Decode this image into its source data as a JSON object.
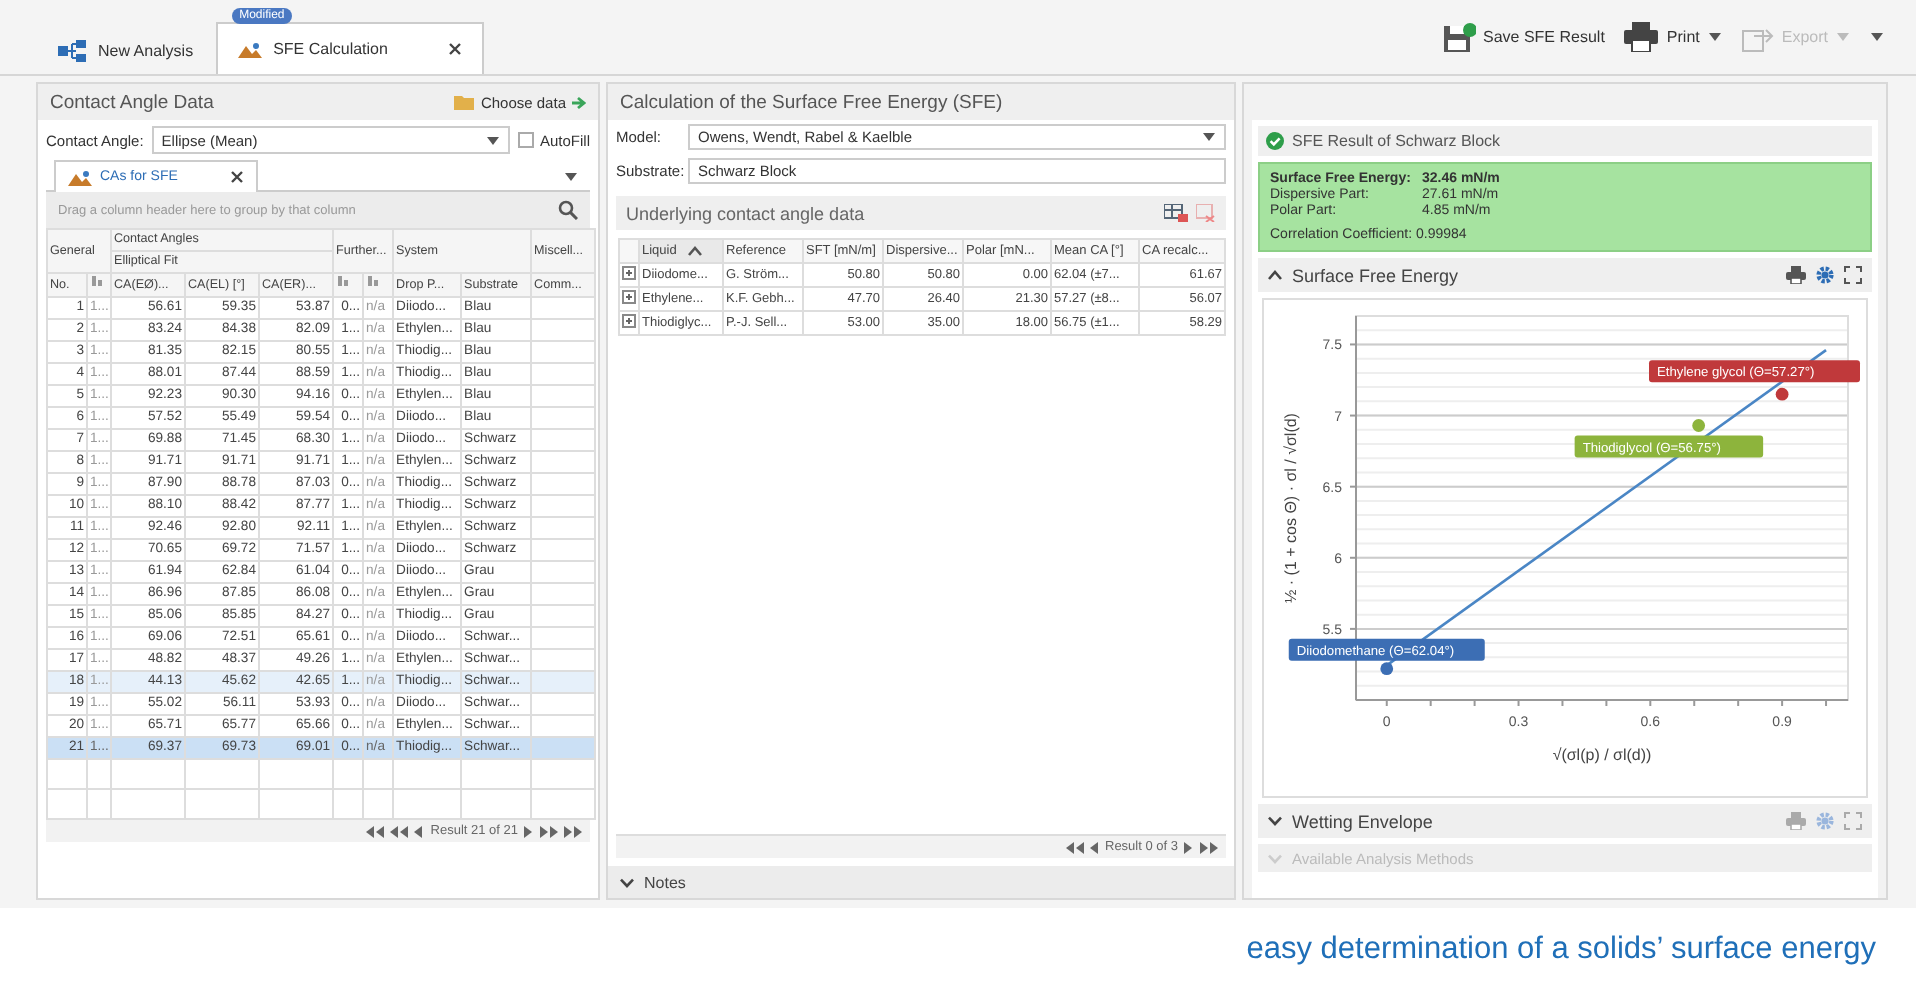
{
  "tabs": [
    {
      "label": "New Analysis",
      "selected": false,
      "closable": false
    },
    {
      "label": "SFE Calculation",
      "selected": true,
      "closable": true,
      "badge": "Modified"
    }
  ],
  "toolbar": [
    {
      "label": "Save SFE Result",
      "kind": "save",
      "disabled": false,
      "dropdown": false
    },
    {
      "label": "Print",
      "kind": "print",
      "disabled": false,
      "dropdown": true
    },
    {
      "label": "Export",
      "kind": "export",
      "disabled": true,
      "dropdown": true
    }
  ],
  "contact_angle_data": {
    "title": "Contact Angle Data",
    "choose_data": "Choose data",
    "angle_label": "Contact Angle:",
    "angle_value": "Ellipse (Mean)",
    "autofill": {
      "label": "AutoFill",
      "checked": false
    },
    "tab": "CAs for SFE",
    "group_hint": "Drag a column header here to group by that column",
    "column_groups": [
      {
        "label": "General",
        "columns": [
          {
            "label": "No.",
            "kind": "text"
          },
          {
            "kind": "icon"
          }
        ]
      },
      {
        "label": "Contact Angles",
        "subgroup": "Elliptical Fit",
        "columns": [
          {
            "label": "CA(EØ)...",
            "kind": "text"
          },
          {
            "label": "CA(EL) [°]",
            "kind": "text"
          },
          {
            "label": "CA(ER)...",
            "kind": "text"
          }
        ]
      },
      {
        "label": "Further...",
        "columns": [
          {
            "kind": "icon"
          },
          {
            "kind": "icon"
          }
        ]
      },
      {
        "label": "System",
        "columns": [
          {
            "label": "Drop P...",
            "kind": "text"
          },
          {
            "label": "Substrate",
            "kind": "text"
          }
        ]
      },
      {
        "label": "Miscell...",
        "columns": [
          {
            "label": "Comm...",
            "kind": "text"
          }
        ]
      }
    ],
    "rows": [
      {
        "cells": [
          "1",
          "1...",
          "56.61",
          "59.35",
          "53.87",
          "0...",
          "n/a",
          "Diiodo...",
          "Blau"
        ],
        "selected": false,
        "highlighted": false
      },
      {
        "cells": [
          "2",
          "1...",
          "83.24",
          "84.38",
          "82.09",
          "1...",
          "n/a",
          "Ethylen...",
          "Blau"
        ],
        "selected": false,
        "highlighted": false
      },
      {
        "cells": [
          "3",
          "1...",
          "81.35",
          "82.15",
          "80.55",
          "1...",
          "n/a",
          "Thiodig...",
          "Blau"
        ],
        "selected": false,
        "highlighted": false
      },
      {
        "cells": [
          "4",
          "1...",
          "88.01",
          "87.44",
          "88.59",
          "1...",
          "n/a",
          "Thiodig...",
          "Blau"
        ],
        "selected": false,
        "highlighted": false
      },
      {
        "cells": [
          "5",
          "1...",
          "92.23",
          "90.30",
          "94.16",
          "0...",
          "n/a",
          "Ethylen...",
          "Blau"
        ],
        "selected": false,
        "highlighted": false
      },
      {
        "cells": [
          "6",
          "1...",
          "57.52",
          "55.49",
          "59.54",
          "0...",
          "n/a",
          "Diiodo...",
          "Blau"
        ],
        "selected": false,
        "highlighted": false
      },
      {
        "cells": [
          "7",
          "1...",
          "69.88",
          "71.45",
          "68.30",
          "1...",
          "n/a",
          "Diiodo...",
          "Schwarz"
        ],
        "selected": false,
        "highlighted": false
      },
      {
        "cells": [
          "8",
          "1...",
          "91.71",
          "91.71",
          "91.71",
          "1...",
          "n/a",
          "Ethylen...",
          "Schwarz"
        ],
        "selected": false,
        "highlighted": false
      },
      {
        "cells": [
          "9",
          "1...",
          "87.90",
          "88.78",
          "87.03",
          "0...",
          "n/a",
          "Thiodig...",
          "Schwarz"
        ],
        "selected": false,
        "highlighted": false
      },
      {
        "cells": [
          "10",
          "1...",
          "88.10",
          "88.42",
          "87.77",
          "1...",
          "n/a",
          "Thiodig...",
          "Schwarz"
        ],
        "selected": false,
        "highlighted": false
      },
      {
        "cells": [
          "11",
          "1...",
          "92.46",
          "92.80",
          "92.11",
          "1...",
          "n/a",
          "Ethylen...",
          "Schwarz"
        ],
        "selected": false,
        "highlighted": false
      },
      {
        "cells": [
          "12",
          "1...",
          "70.65",
          "69.72",
          "71.57",
          "1...",
          "n/a",
          "Diiodo...",
          "Schwarz"
        ],
        "selected": false,
        "highlighted": false
      },
      {
        "cells": [
          "13",
          "1...",
          "61.94",
          "62.84",
          "61.04",
          "0...",
          "n/a",
          "Diiodo...",
          "Grau"
        ],
        "selected": false,
        "highlighted": false
      },
      {
        "cells": [
          "14",
          "1...",
          "86.96",
          "87.85",
          "86.08",
          "0...",
          "n/a",
          "Ethylen...",
          "Grau"
        ],
        "selected": false,
        "highlighted": false
      },
      {
        "cells": [
          "15",
          "1...",
          "85.06",
          "85.85",
          "84.27",
          "0...",
          "n/a",
          "Thiodig...",
          "Grau"
        ],
        "selected": false,
        "highlighted": false
      },
      {
        "cells": [
          "16",
          "1...",
          "69.06",
          "72.51",
          "65.61",
          "0...",
          "n/a",
          "Diiodo...",
          "Schwar..."
        ],
        "selected": false,
        "highlighted": false
      },
      {
        "cells": [
          "17",
          "1...",
          "48.82",
          "48.37",
          "49.26",
          "1...",
          "n/a",
          "Ethylen...",
          "Schwar..."
        ],
        "selected": false,
        "highlighted": false
      },
      {
        "cells": [
          "18",
          "1...",
          "44.13",
          "45.62",
          "42.65",
          "1...",
          "n/a",
          "Thiodig...",
          "Schwar..."
        ],
        "selected": false,
        "highlighted": true
      },
      {
        "cells": [
          "19",
          "1...",
          "55.02",
          "56.11",
          "53.93",
          "0...",
          "n/a",
          "Diiodo...",
          "Schwar..."
        ],
        "selected": false,
        "highlighted": false
      },
      {
        "cells": [
          "20",
          "1...",
          "65.71",
          "65.77",
          "65.66",
          "0...",
          "n/a",
          "Ethylen...",
          "Schwar..."
        ],
        "selected": false,
        "highlighted": false
      },
      {
        "cells": [
          "21",
          "1...",
          "69.37",
          "69.73",
          "69.01",
          "0...",
          "n/a",
          "Thiodig...",
          "Schwar..."
        ],
        "selected": true,
        "highlighted": false
      }
    ],
    "pager": "Result 21 of 21"
  },
  "sfe_calculation": {
    "title": "Calculation of the Surface Free Energy (SFE)",
    "model_label": "Model:",
    "model": "Owens, Wendt, Rabel & Kaelble",
    "substrate_label": "Substrate:",
    "substrate": "Schwarz Block",
    "table_title": "Underlying contact angle data",
    "columns": [
      {
        "label": "Liquid",
        "sorted": true
      },
      {
        "label": "Reference",
        "sorted": false
      },
      {
        "label": "SFT [mN/m]",
        "sorted": false
      },
      {
        "label": "Dispersive...",
        "sorted": false
      },
      {
        "label": "Polar [mN...",
        "sorted": false
      },
      {
        "label": "Mean CA [°]",
        "sorted": false
      },
      {
        "label": "CA recalc...",
        "sorted": false
      }
    ],
    "rows": [
      {
        "cells": [
          "Diiodome...",
          "G. Ström...",
          "50.80",
          "50.80",
          "0.00",
          "62.04 (±7...",
          "61.67"
        ],
        "expanded": false
      },
      {
        "cells": [
          "Ethylene...",
          "K.F. Gebh...",
          "47.70",
          "26.40",
          "21.30",
          "57.27 (±8...",
          "56.07"
        ],
        "expanded": false
      },
      {
        "cells": [
          "Thiodiglyc...",
          "P.-J. Sell...",
          "53.00",
          "35.00",
          "18.00",
          "56.75 (±1...",
          "58.29"
        ],
        "expanded": false
      }
    ],
    "pager": "Result 0 of 3",
    "notes": {
      "label": "Notes",
      "expanded": false
    }
  },
  "sfe_result": {
    "title": "SFE Result of Schwarz Block",
    "values": [
      {
        "label": "Surface Free Energy:",
        "value": "32.46 mN/m",
        "emphasis": true
      },
      {
        "label": "Dispersive Part:",
        "value": "27.61 mN/m",
        "emphasis": false
      },
      {
        "label": "Polar Part:",
        "value": "4.85 mN/m",
        "emphasis": false
      }
    ],
    "correlation": {
      "label": "Correlation Coefficient:",
      "value": "0.99984"
    }
  },
  "sections": [
    {
      "title": "Surface Free Energy",
      "expanded": true,
      "disabled": false,
      "chart_data": {
        "type": "scatter",
        "xlabel": "√(σl(p) / σl(d))",
        "ylabel": "½ · (1 + cos Θ) · σl / √σl(d)",
        "x": [
          0,
          0.71,
          0.9
        ],
        "series": [
          {
            "name": "Diiodomethane (Θ=62.04°)",
            "color": "#3c6eb4",
            "values": [
              5.22,
              null,
              null
            ]
          },
          {
            "name": "Thiodiglycol (Θ=56.75°)",
            "color": "#8db43c",
            "values": [
              null,
              6.93,
              null
            ]
          },
          {
            "name": "Ethylene glycol (Θ=57.27°)",
            "color": "#c0393b",
            "values": [
              null,
              null,
              7.15
            ]
          }
        ],
        "grid": true,
        "xlim": [
          -0.07,
          1.05
        ],
        "ylim": [
          5,
          7.7
        ],
        "xticks": [
          0,
          0.3,
          0.6,
          0.9
        ],
        "yticks": [
          5.5,
          6,
          6.5,
          7,
          7.5
        ]
      }
    },
    {
      "title": "Wetting Envelope",
      "expanded": false,
      "disabled": false
    },
    {
      "title": "Available Analysis Methods",
      "expanded": false,
      "disabled": true
    }
  ],
  "caption": "easy determination of a solids’ surface energy"
}
